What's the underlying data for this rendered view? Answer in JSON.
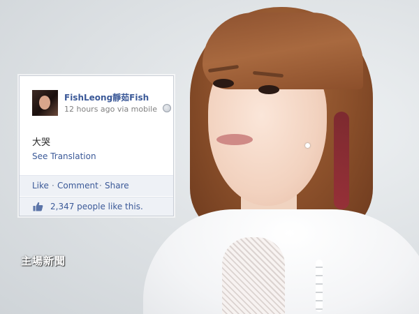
{
  "post": {
    "author": "FishLeong靜茹Fish",
    "timestamp": "12 hours ago",
    "via": "via mobile",
    "privacy_icon": "globe-icon",
    "text": "大哭",
    "see_translation": "See Translation"
  },
  "actions": {
    "like": "Like",
    "comment": "Comment",
    "share": "Share",
    "separator": "·"
  },
  "likes": {
    "icon": "thumbs-up-icon",
    "text": "2,347 people like this."
  },
  "watermark": {
    "text": "主場新聞"
  },
  "colors": {
    "link": "#3b5998",
    "action_bar": "#eef1f6",
    "meta_text": "#808080"
  }
}
